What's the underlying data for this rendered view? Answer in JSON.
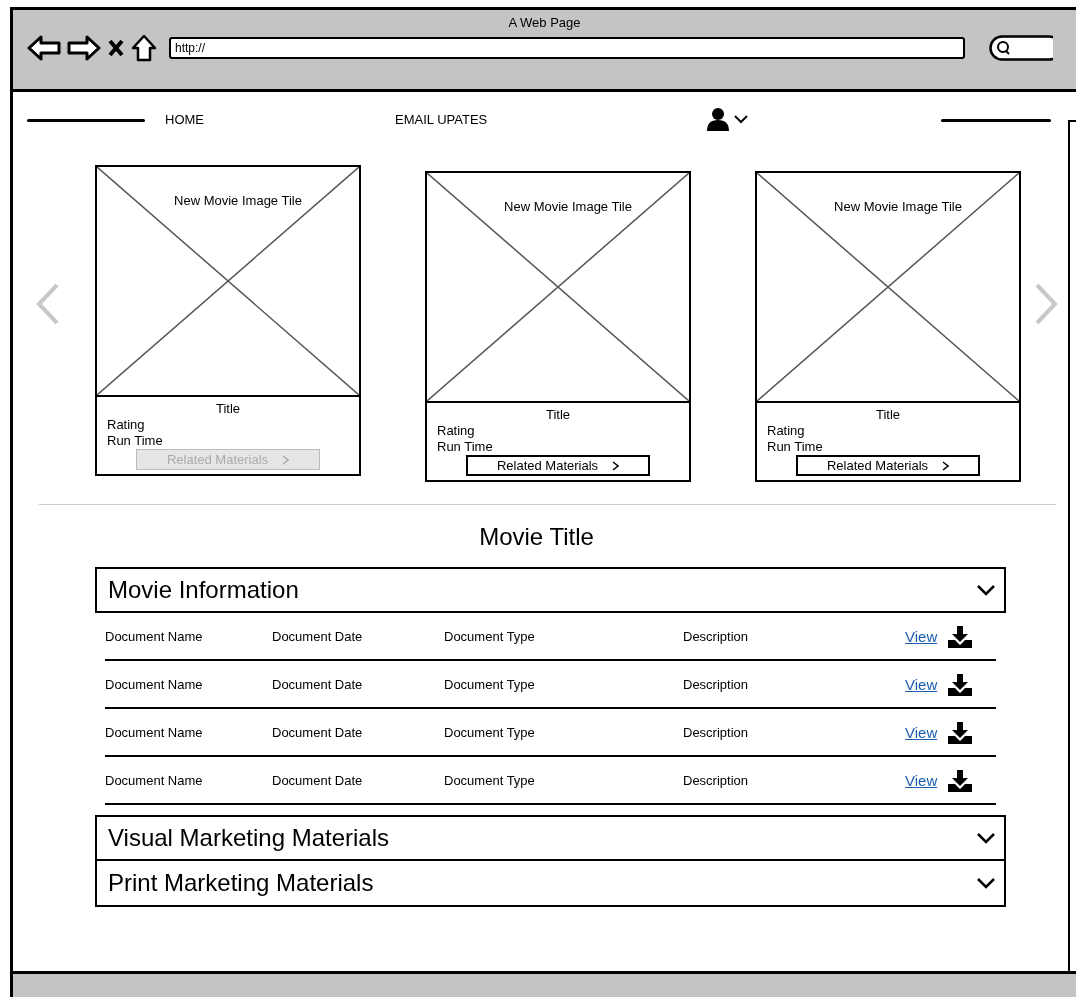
{
  "window": {
    "title": "A Web Page",
    "url": "http://"
  },
  "nav": {
    "items": [
      {
        "label": "HOME"
      },
      {
        "label": "EMAIL UPATES"
      }
    ]
  },
  "carousel": {
    "tiles": [
      {
        "image_label": "New Movie Image Tile",
        "title": "Title",
        "rating": "Rating",
        "run_time": "Run Time",
        "button": "Related Materials",
        "disabled": true
      },
      {
        "image_label": "New Movie Image Tile",
        "title": "Title",
        "rating": "Rating",
        "run_time": "Run Time",
        "button": "Related Materials",
        "disabled": false
      },
      {
        "image_label": "New Movie Image Tile",
        "title": "Title",
        "rating": "Rating",
        "run_time": "Run Time",
        "button": "Related Materials",
        "disabled": false
      }
    ]
  },
  "movie_title": "Movie Title",
  "sections": [
    {
      "title": "Movie Information",
      "rows": [
        {
          "name": "Document Name",
          "date": "Document Date",
          "type": "Document Type",
          "description": "Description",
          "link": "View"
        },
        {
          "name": "Document Name",
          "date": "Document Date",
          "type": "Document Type",
          "description": "Description",
          "link": "View"
        },
        {
          "name": "Document Name",
          "date": "Document Date",
          "type": "Document Type",
          "description": "Description",
          "link": "View"
        },
        {
          "name": "Document Name",
          "date": "Document Date",
          "type": "Document Type",
          "description": "Description",
          "link": "View"
        }
      ]
    },
    {
      "title": "Visual Marketing Materials"
    },
    {
      "title": "Print Marketing Materials"
    }
  ]
}
